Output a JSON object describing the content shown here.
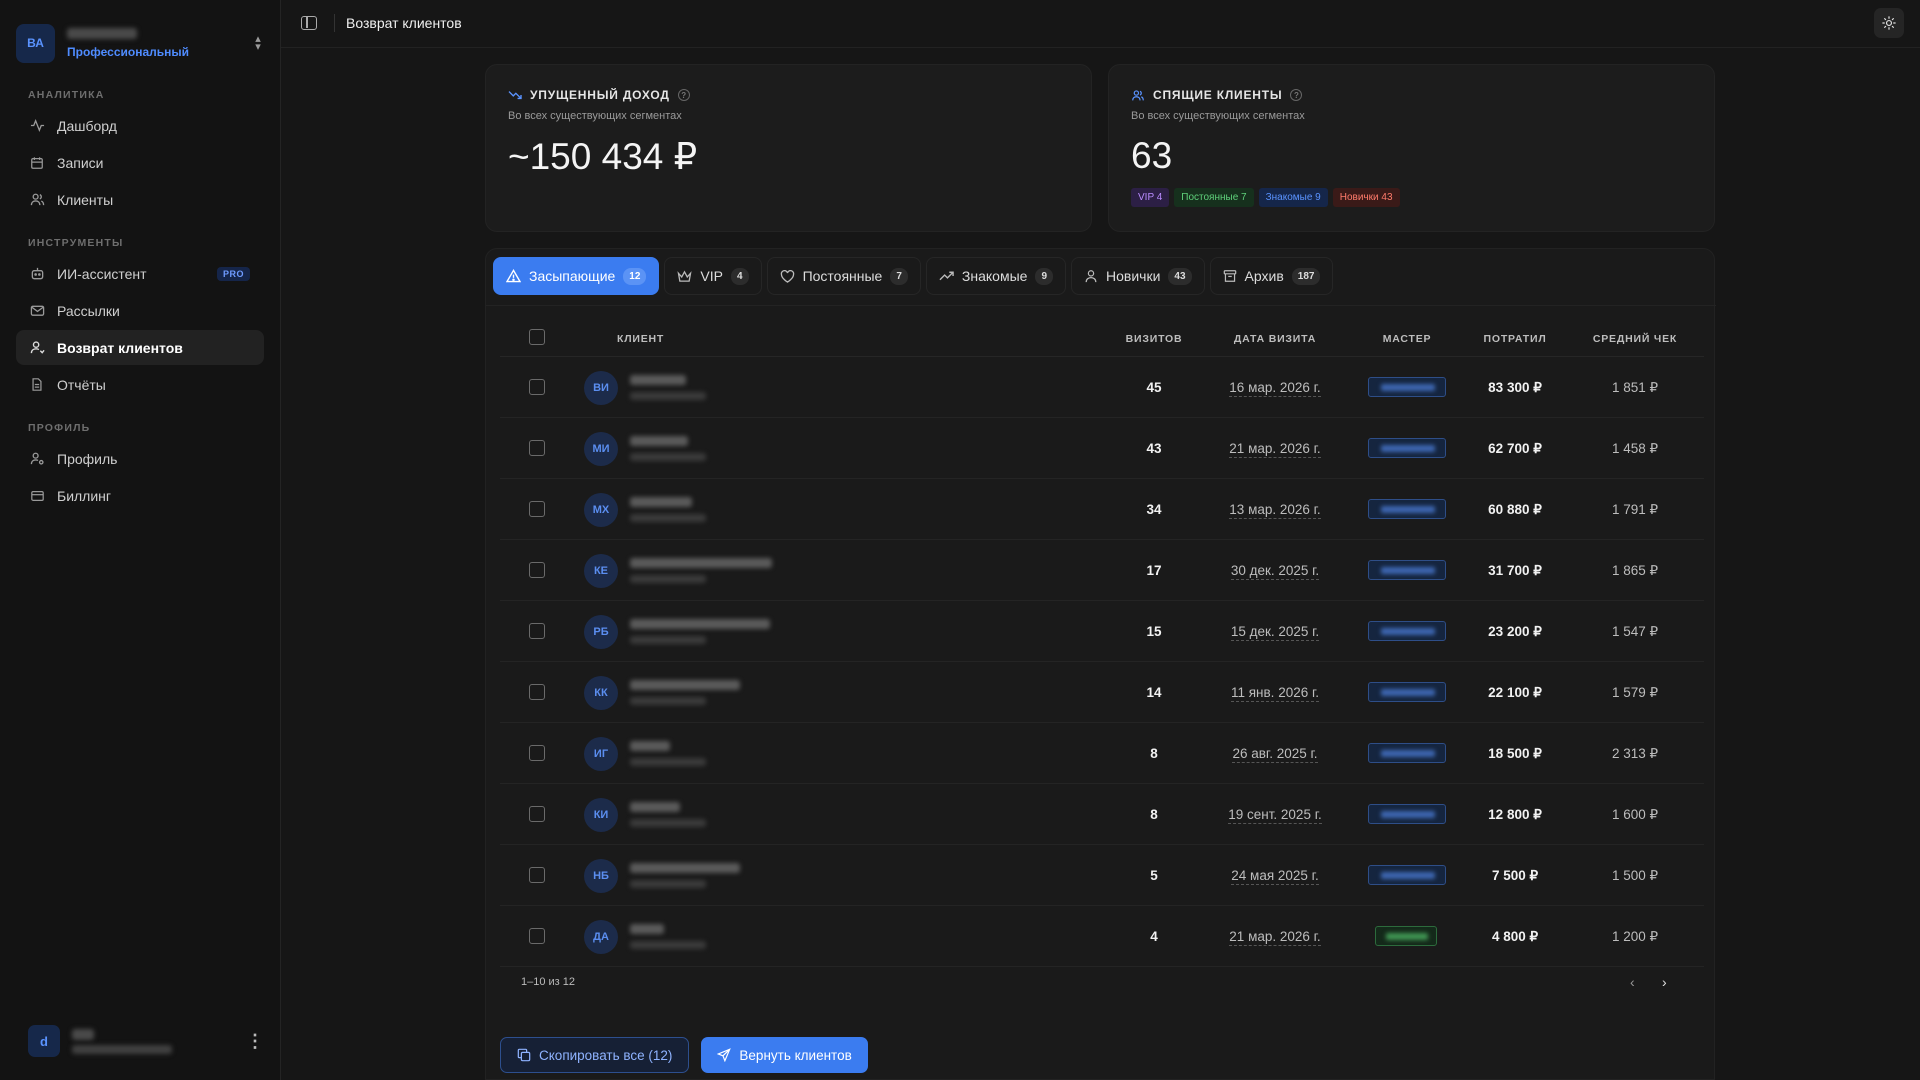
{
  "sidebar": {
    "account": {
      "initials": "ВА",
      "plan": "Профессиональный"
    },
    "sections": [
      {
        "title": "АНАЛИТИКА"
      },
      {
        "title": "ИНСТРУМЕНТЫ"
      },
      {
        "title": "ПРОФИЛЬ"
      }
    ],
    "items": [
      {
        "label": "Дашборд",
        "icon": "activity-icon"
      },
      {
        "label": "Записи",
        "icon": "calendar-icon"
      },
      {
        "label": "Клиенты",
        "icon": "users-icon"
      },
      {
        "label": "ИИ-ассистент",
        "icon": "bot-icon",
        "badge": "PRO"
      },
      {
        "label": "Рассылки",
        "icon": "mail-icon"
      },
      {
        "label": "Возврат клиентов",
        "icon": "user-return-icon",
        "active": true
      },
      {
        "label": "Отчёты",
        "icon": "file-icon"
      },
      {
        "label": "Профиль",
        "icon": "user-settings-icon"
      },
      {
        "label": "Биллинг",
        "icon": "card-icon"
      }
    ],
    "user": {
      "initial": "d"
    }
  },
  "topbar": {
    "title": "Возврат клиентов"
  },
  "lost_income": {
    "title": "УПУЩЕННЫЙ ДОХОД",
    "subtitle": "Во всех существующих сегментах",
    "value": "~150 434 ₽"
  },
  "sleeping": {
    "title": "СПЯЩИЕ КЛИЕНТЫ",
    "subtitle": "Во всех существующих сегментах",
    "value": "63",
    "badges": [
      {
        "label": "VIP 4",
        "color": "#b98cff",
        "bg": "#2c1f45"
      },
      {
        "label": "Постоянные 7",
        "color": "#5fd07a",
        "bg": "#16301d"
      },
      {
        "label": "Знакомые 9",
        "color": "#5a93ff",
        "bg": "#15264a"
      },
      {
        "label": "Новички 43",
        "color": "#ff7b6b",
        "bg": "#3a1a18"
      }
    ]
  },
  "tabs": [
    {
      "label": "Засыпающие",
      "count": "12",
      "icon": "alert-triangle-icon",
      "active": true
    },
    {
      "label": "VIP",
      "count": "4",
      "icon": "crown-icon"
    },
    {
      "label": "Постоянные",
      "count": "7",
      "icon": "heart-icon"
    },
    {
      "label": "Знакомые",
      "count": "9",
      "icon": "trending-up-icon"
    },
    {
      "label": "Новички",
      "count": "43",
      "icon": "user-icon"
    },
    {
      "label": "Архив",
      "count": "187",
      "icon": "archive-icon"
    }
  ],
  "table": {
    "columns": {
      "client": "КЛИЕНТ",
      "visits": "ВИЗИТОВ",
      "date": "ДАТА ВИЗИТА",
      "master": "МАСТЕР",
      "spent": "ПОТРАТИЛ",
      "avg": "СРЕДНИЙ ЧЕК"
    },
    "rows": [
      {
        "initials": "ВИ",
        "visits": "45",
        "date": "16 мар. 2026 г.",
        "spent": "83 300 ₽",
        "avg": "1 851 ₽",
        "master_status": "blue"
      },
      {
        "initials": "МИ",
        "visits": "43",
        "date": "21 мар. 2026 г.",
        "spent": "62 700 ₽",
        "avg": "1 458 ₽",
        "master_status": "blue"
      },
      {
        "initials": "МХ",
        "visits": "34",
        "date": "13 мар. 2026 г.",
        "spent": "60 880 ₽",
        "avg": "1 791 ₽",
        "master_status": "blue"
      },
      {
        "initials": "КЕ",
        "visits": "17",
        "date": "30 дек. 2025 г.",
        "spent": "31 700 ₽",
        "avg": "1 865 ₽",
        "master_status": "blue"
      },
      {
        "initials": "РБ",
        "visits": "15",
        "date": "15 дек. 2025 г.",
        "spent": "23 200 ₽",
        "avg": "1 547 ₽",
        "master_status": "blue"
      },
      {
        "initials": "КК",
        "visits": "14",
        "date": "11 янв. 2026 г.",
        "spent": "22 100 ₽",
        "avg": "1 579 ₽",
        "master_status": "blue"
      },
      {
        "initials": "ИГ",
        "visits": "8",
        "date": "26 авг. 2025 г.",
        "spent": "18 500 ₽",
        "avg": "2 313 ₽",
        "master_status": "blue"
      },
      {
        "initials": "КИ",
        "visits": "8",
        "date": "19 сент. 2025 г.",
        "spent": "12 800 ₽",
        "avg": "1 600 ₽",
        "master_status": "blue"
      },
      {
        "initials": "НБ",
        "visits": "5",
        "date": "24 мая 2025 г.",
        "spent": "7 500 ₽",
        "avg": "1 500 ₽",
        "master_status": "blue"
      },
      {
        "initials": "ДА",
        "visits": "4",
        "date": "21 мар. 2026 г.",
        "spent": "4 800 ₽",
        "avg": "1 200 ₽",
        "master_status": "green"
      }
    ]
  },
  "pagination": {
    "range": "1–10 из 12"
  },
  "actions": {
    "copy": "Скопировать все (12)",
    "return": "Вернуть клиентов"
  }
}
